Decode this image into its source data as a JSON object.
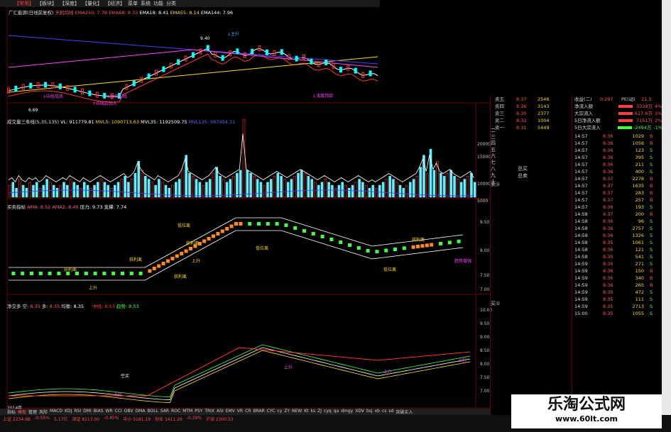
{
  "menu": [
    "【常用】",
    "【板块】",
    "【深度】",
    "【量化】",
    "【经济】",
    "菜单",
    "系统",
    "功能",
    "分类"
  ],
  "main_info": {
    "title": "广汇能源(日线前复权)",
    "mode": "天机均线",
    "ema250": "EMA250: 7.78",
    "ema68": "EMA68: 8.33",
    "ema18": "EMA18: 8.41",
    "ema55": "EMA55: 8.14",
    "ema144": "EMA144: 7.96"
  },
  "main_annotations": {
    "high": "9.40",
    "low": "6.69",
    "high_marker": "↓主升",
    "low_marker": "↑中线启动入",
    "bottom_marker": "↓中线见底",
    "bottom_marker2": "↓水位中线",
    "end_marker": "↓浅度顶部"
  },
  "vol_info": {
    "title": "成交量三条线(5,35,135)",
    "vl": "VL: 911779.81",
    "mvl5": "MVL5: 1090713.63",
    "mvl35": "MVL35: 1192509.75",
    "mvl135": "MVL135: 987454.31"
  },
  "vol_axis": [
    "20000",
    "15000",
    "10000",
    "5000"
  ],
  "vol_values": [
    4,
    5,
    3,
    6,
    4,
    3,
    5,
    4,
    5,
    3,
    4,
    6,
    5,
    4,
    3,
    4,
    5,
    4,
    6,
    5,
    4,
    3,
    5,
    4,
    3,
    4,
    5,
    6,
    5,
    4,
    3,
    4,
    5,
    6,
    7,
    5,
    6,
    8,
    12,
    9,
    7,
    6,
    5,
    4,
    6,
    5,
    4,
    3,
    4,
    5,
    6,
    9,
    14,
    8,
    7,
    6,
    5,
    4,
    5,
    6,
    8,
    10,
    7,
    6,
    5,
    6,
    7,
    8,
    9,
    26,
    9,
    8,
    7,
    6,
    5,
    4,
    5,
    6,
    7,
    8,
    7,
    6,
    5,
    6,
    7,
    8,
    9,
    8,
    7,
    6,
    5,
    4,
    5,
    6,
    5,
    4,
    3,
    4,
    5,
    4,
    3,
    4,
    5,
    6,
    5,
    4,
    3,
    4,
    3,
    4,
    5,
    6,
    7,
    6,
    5,
    4,
    3,
    4,
    5,
    6,
    7,
    10,
    14,
    8,
    16,
    9,
    12,
    8,
    7,
    8,
    9,
    7,
    6,
    5,
    6,
    7,
    8,
    5
  ],
  "buysell_info": {
    "title": "买卖指标",
    "ama": "AMA: 8.52",
    "ama2": "AMA2: 8.40",
    "pressure": "压力: 9.73",
    "support": "支撑: 7.74"
  },
  "buysell_axis": [
    "8.50",
    "8.00",
    "7.50",
    "7.00"
  ],
  "buysell_labels": [
    "获利离",
    "获利离",
    "获利离",
    "获利离",
    "上升",
    "上升",
    "低位离",
    "低位离",
    "低位离",
    "获利离",
    "趋势增强"
  ],
  "trend_info": {
    "title": "净交多",
    "kong": "8.35",
    "kong_label": "空:",
    "duo": "8.35",
    "duo_label": "多:",
    "balance": "8.35",
    "balance_label": "均衡:",
    "zhongxian": "中线: 8.53",
    "qushi": "趋势: 8.53"
  },
  "trend_axis": [
    "10.00",
    "9.50",
    "9.00",
    "8.50",
    "8.00",
    "7.50",
    "7.00"
  ],
  "trend_labels": [
    "空买",
    "上升",
    "上升",
    "上升",
    "上升"
  ],
  "date_label": "2014年",
  "depth": {
    "rows": [
      {
        "label": "卖五",
        "price": "8.37",
        "vol": "2546"
      },
      {
        "label": "卖四",
        "price": "8.36",
        "vol": "3143"
      },
      {
        "label": "卖三",
        "price": "8.35",
        "vol": "2377"
      },
      {
        "label": "卖二",
        "price": "8.32",
        "vol": "1004"
      },
      {
        "label": "卖一",
        "price": "8.31",
        "vol": "5449"
      }
    ],
    "side_labels": [
      "二",
      "三",
      "四",
      "五",
      "六",
      "七",
      "八",
      "九",
      "十"
    ],
    "total_buy": "总买",
    "total_sell": "总卖",
    "buy_label": "买①",
    "sell_label": "卖①"
  },
  "flows": {
    "ratio": "收益(二)",
    "ratio_val": "0.297",
    "pe": "PE(动)",
    "pe_val": "21.3",
    "items": [
      {
        "label": "净流入额",
        "value": "3339万",
        "pct": "4%"
      },
      {
        "label": "大宗流入",
        "value": "617.6万",
        "pct": "1%"
      },
      {
        "label": "5日净流入额",
        "value": "7151万",
        "pct": "2%"
      },
      {
        "label": "5日大宗流入",
        "value": "-2494万",
        "pct": "-1%"
      }
    ]
  },
  "ticks": [
    {
      "t": "14:57",
      "p": "8.36",
      "v": "1029",
      "f": "B"
    },
    {
      "t": "14:57",
      "p": "8.36",
      "v": "1056",
      "f": "B"
    },
    {
      "t": "14:57",
      "p": "8.36",
      "v": "123",
      "f": "S"
    },
    {
      "t": "14:57",
      "p": "8.36",
      "v": "395",
      "f": "S"
    },
    {
      "t": "14:57",
      "p": "8.36",
      "v": "211",
      "f": "S"
    },
    {
      "t": "14:57",
      "p": "8.36",
      "v": "400",
      "f": "S"
    },
    {
      "t": "14:57",
      "p": "8.37",
      "v": "2278",
      "f": "B"
    },
    {
      "t": "14:57",
      "p": "8.37",
      "v": "1635",
      "f": "B"
    },
    {
      "t": "14:57",
      "p": "8.37",
      "v": "283",
      "f": "B"
    },
    {
      "t": "14:57",
      "p": "8.37",
      "v": "257",
      "f": "B"
    },
    {
      "t": "14:57",
      "p": "8.36",
      "v": "193",
      "f": "S"
    },
    {
      "t": "14:58",
      "p": "8.37",
      "v": "200",
      "f": "B"
    },
    {
      "t": "14:58",
      "p": "8.36",
      "v": "96",
      "f": "S"
    },
    {
      "t": "14:58",
      "p": "8.36",
      "v": "2757",
      "f": "S"
    },
    {
      "t": "14:58",
      "p": "8.36",
      "v": "1326",
      "f": "S"
    },
    {
      "t": "14:58",
      "p": "8.35",
      "v": "1061",
      "f": "S"
    },
    {
      "t": "14:58",
      "p": "8.36",
      "v": "121",
      "f": "S"
    },
    {
      "t": "14:58",
      "p": "8.35",
      "v": "541",
      "f": "S"
    },
    {
      "t": "14:59",
      "p": "8.35",
      "v": "271",
      "f": "S"
    },
    {
      "t": "14:59",
      "p": "8.36",
      "v": "150",
      "f": "B"
    },
    {
      "t": "14:59",
      "p": "8.36",
      "v": "340",
      "f": "B"
    },
    {
      "t": "14:59",
      "p": "8.36",
      "v": "265",
      "f": "B"
    },
    {
      "t": "14:59",
      "p": "8.35",
      "v": "472",
      "f": "S"
    },
    {
      "t": "14:59",
      "p": "8.35",
      "v": "111",
      "f": "S"
    },
    {
      "t": "14:59",
      "p": "8.35",
      "v": "2713",
      "f": "S"
    },
    {
      "t": "15:00",
      "p": "8.35",
      "v": "1055",
      "f": "S"
    }
  ],
  "tabs": [
    "指标",
    "模板",
    "管理",
    "风险",
    "MACD",
    "KDJ",
    "RSI",
    "DMI",
    "BIAS",
    "WR",
    "CCI",
    "OBV",
    "DMA",
    "BOLL",
    "SAR",
    "ROC",
    "MTM",
    "PSY",
    "TRIX",
    "ASI",
    "EMV",
    "VR",
    "CR",
    "BRAR",
    "CYC",
    "cy",
    "ZY",
    "NEW",
    "Kt",
    "ks",
    "ZJ",
    "cyq",
    "qa",
    "dmgy",
    "XDV",
    "bsj",
    "xb",
    "cs",
    "sd",
    "突破买入"
  ],
  "status": [
    "上证 2234.98",
    "-0.55%",
    "5.17亿",
    "深证 8117.00",
    "-0.45%",
    "中小 5181.19",
    "创业 1411.26",
    "-0.39%",
    "沪深 2300.53"
  ],
  "watermark": {
    "title": "乐淘公式网",
    "url": "www.60lt.com"
  }
}
